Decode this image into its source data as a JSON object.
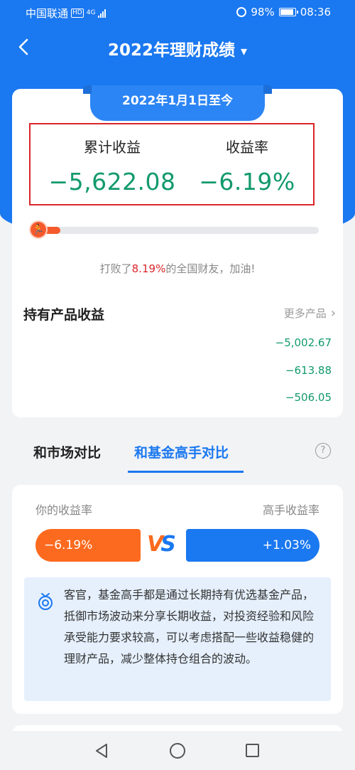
{
  "status_bar": {
    "carrier": "中国联通",
    "hd": "HD",
    "network": "4G",
    "battery": "98%",
    "time": "08:36"
  },
  "header": {
    "title": "2022年理财成绩",
    "title_caret": "▾"
  },
  "summary": {
    "date_range": "2022年1月1日至今",
    "cumulative_label": "累计收益",
    "cumulative_value": "−5,622.08",
    "rate_label": "收益率",
    "rate_value": "−6.19%",
    "beat_prefix": "打败了",
    "beat_percent": "8.19%",
    "beat_suffix": "的全国财友，加油!",
    "beat_progress": 0.0819
  },
  "holdings": {
    "title": "持有产品收益",
    "more_label": "更多产品",
    "values": [
      "−5,002.67",
      "−613.88",
      "−506.05"
    ]
  },
  "compare": {
    "tabs": [
      "和市场对比",
      "和基金高手对比"
    ],
    "active_tab": 1,
    "help": "?",
    "your_rate_label": "你的收益率",
    "expert_rate_label": "高手收益率",
    "your_rate": "−6.19%",
    "expert_rate": "+1.03%",
    "vs_v": "V",
    "vs_s": "S",
    "tip": "客官，基金高手都是通过长期持有优选基金产品，抵御市场波动来分享长期收益，对投资经验和风险承受能力要求较高，可以考虑搭配一些收益稳健的理财产品，减少整体持仓组合的波动。"
  },
  "colors": {
    "brand_blue": "#1a78f0",
    "loss_green": "#139a6c",
    "highlight_red": "#d9262a",
    "orange": "#fb6a1e"
  },
  "icons": [
    "back-icon",
    "caret-down-icon",
    "runner-icon",
    "chevron-right-icon",
    "help-icon",
    "bell-tip-icon",
    "nav-back-icon",
    "nav-home-icon",
    "nav-recent-icon"
  ]
}
